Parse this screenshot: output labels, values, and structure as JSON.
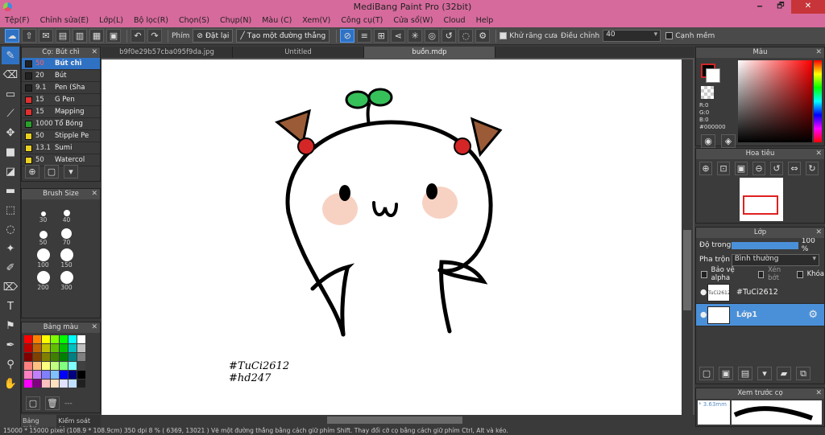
{
  "window": {
    "title": "MediBang Paint Pro (32bit)",
    "min": "🗕",
    "max": "🗗",
    "close": "✕"
  },
  "menu": [
    "Tệp(F)",
    "Chỉnh sửa(E)",
    "Lớp(L)",
    "Bộ lọc(R)",
    "Chọn(S)",
    "Chụp(N)",
    "Màu (C)",
    "Xem(V)",
    "Công cụ(T)",
    "Cửa sổ(W)",
    "Cloud",
    "Help"
  ],
  "toolbar": {
    "phim_label": "Phím",
    "reset_label": "Đặt lại",
    "straight_line_label": "Tạo một đường thẳng",
    "antialias_label": "Khử răng cưa",
    "correction_label": "Điều chỉnh",
    "correction_value": "40",
    "edge_label": "Cạnh mềm"
  },
  "tabs": [
    {
      "label": "b9f0e29b57cba095f9da.jpg"
    },
    {
      "label": "Untitled"
    },
    {
      "label": "buồn.mdp"
    }
  ],
  "brush_panel": {
    "title": "Cọ: Bút chì",
    "items": [
      {
        "size": "50",
        "name": "Bút chì",
        "color": "#222222",
        "selected": true
      },
      {
        "size": "20",
        "name": "Bút",
        "color": "#222222"
      },
      {
        "size": "9.1",
        "name": "Pen (Sha",
        "color": "#222222"
      },
      {
        "size": "15",
        "name": "G Pen",
        "color": "#e03030"
      },
      {
        "size": "15",
        "name": "Mapping",
        "color": "#e03030"
      },
      {
        "size": "1000",
        "name": "Tổ Bóng",
        "color": "#2aa02a"
      },
      {
        "size": "50",
        "name": "Stipple Pe",
        "color": "#e8d020"
      },
      {
        "size": "13.1",
        "name": "Sumi",
        "color": "#e8d020"
      },
      {
        "size": "50",
        "name": "Watercol",
        "color": "#e8d020"
      }
    ]
  },
  "brush_size_panel": {
    "title": "Brush Size",
    "sizes": [
      "30",
      "40",
      "50",
      "70",
      "100",
      "150",
      "200",
      "300"
    ]
  },
  "palette_panel": {
    "title": "Bảng màu",
    "colors": [
      "#ff0000",
      "#ff8000",
      "#ffff00",
      "#80ff00",
      "#00ff00",
      "#00ffff",
      "#ffffff",
      "#c00000",
      "#c06000",
      "#c0c000",
      "#60c000",
      "#00c000",
      "#00c0c0",
      "#c0c0c0",
      "#800000",
      "#804000",
      "#808000",
      "#408000",
      "#008000",
      "#008080",
      "#808080",
      "#ff8080",
      "#ffc080",
      "#ffff80",
      "#c0ff80",
      "#80ff80",
      "#80ffff",
      "#404040",
      "#ff80c0",
      "#c080ff",
      "#8080ff",
      "#80c0ff",
      "#0000ff",
      "#000080",
      "#000000",
      "#ff00ff",
      "#800080",
      "#ffc0c0",
      "#ffe0c0",
      "#e0e0ff",
      "#c0e0ff",
      "#202020"
    ],
    "extra": "---"
  },
  "bottom_tabs": [
    "Bảng màu",
    "Kiểm soát co"
  ],
  "canvas_text": {
    "line1": "#TuCi2612",
    "line2": "#hd247"
  },
  "color_panel": {
    "title": "Màu",
    "r": "R:0",
    "g": "G:0",
    "b": "B:0",
    "hex": "#000000"
  },
  "navigator_panel": {
    "title": "Hoa tiêu"
  },
  "layer_panel": {
    "title": "Lớp",
    "opacity_label": "Độ trong",
    "opacity_value": "100 %",
    "blend_label": "Pha trộn",
    "blend_value": "Bình thường",
    "protect_alpha": "Bảo vệ alpha",
    "clipping": "Xén bớt",
    "lock": "Khóa",
    "layers": [
      {
        "name": "#TuCi2612",
        "thumb": "TuCi2612",
        "selected": false
      },
      {
        "name": "Lớp1",
        "thumb": "",
        "selected": true
      }
    ]
  },
  "preview_panel": {
    "title": "Xem trước cọ",
    "size": "* 3.63mm"
  },
  "status": "15000 * 15000 pixel (108.9 * 108.9cm) 350 dpi 8 % ( 6369, 13021 ) Vẽ một đường thẳng bằng cách giữ phím Shift. Thay đổi cỡ cọ bằng cách giữ phím Ctrl, Alt và kéo."
}
